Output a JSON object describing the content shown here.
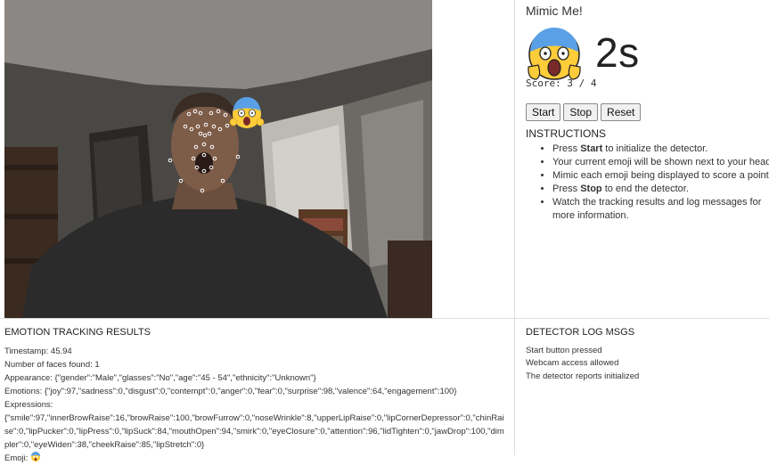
{
  "app": {
    "title": "Mimic Me!",
    "timer": "2s",
    "score": "Score: 3 / 4"
  },
  "controls": {
    "start_label": "Start",
    "stop_label": "Stop",
    "reset_label": "Reset"
  },
  "instructions": {
    "title": "INSTRUCTIONS",
    "items": [
      {
        "pre": "Press ",
        "bold": "Start",
        "post": " to initialize the detector."
      },
      {
        "pre": "Your current emoji will be shown next to your head.",
        "bold": "",
        "post": ""
      },
      {
        "pre": "Mimic each emoji being displayed to score a point!",
        "bold": "",
        "post": ""
      },
      {
        "pre": "Press ",
        "bold": "Stop",
        "post": " to end the detector."
      },
      {
        "pre": "Watch the tracking results and log messages for more information.",
        "bold": "",
        "post": ""
      }
    ]
  },
  "results": {
    "title": "EMOTION TRACKING RESULTS",
    "timestamp": "Timestamp: 45.94",
    "faces": "Number of faces found: 1",
    "appearance": "Appearance: {\"gender\":\"Male\",\"glasses\":\"No\",\"age\":\"45 - 54\",\"ethnicity\":\"Unknown\"}",
    "emotions": "Emotions: {\"joy\":97,\"sadness\":0,\"disgust\":0,\"contempt\":0,\"anger\":0,\"fear\":0,\"surprise\":98,\"valence\":64,\"engagement\":100}",
    "expressions_label": "Expressions:",
    "expressions": "{\"smile\":97,\"innerBrowRaise\":16,\"browRaise\":100,\"browFurrow\":0,\"noseWrinkle\":8,\"upperLipRaise\":0,\"lipCornerDepressor\":0,\"chinRaise\":0,\"lipPucker\":0,\"lipPress\":0,\"lipSuck\":84,\"mouthOpen\":94,\"smirk\":0,\"eyeClosure\":0,\"attention\":96,\"lidTighten\":0,\"jawDrop\":100,\"dimpler\":0,\"eyeWiden\":38,\"cheekRaise\":85,\"lipStretch\":0}",
    "emoji_label": "Emoji: "
  },
  "log": {
    "title": "DETECTOR LOG MSGS",
    "messages": [
      "Start button pressed",
      "Webcam access allowed",
      "The detector reports initialized"
    ]
  },
  "icons": {
    "target_emoji": "screaming-face-emoji-icon",
    "overlay_emoji": "screaming-face-emoji-icon",
    "result_emoji": "screaming-face-emoji-icon"
  },
  "colors": {
    "emoji_yellow": "#ffcc3a",
    "emoji_blue": "#5aa0e6",
    "landmark_white": "#ffffff"
  }
}
